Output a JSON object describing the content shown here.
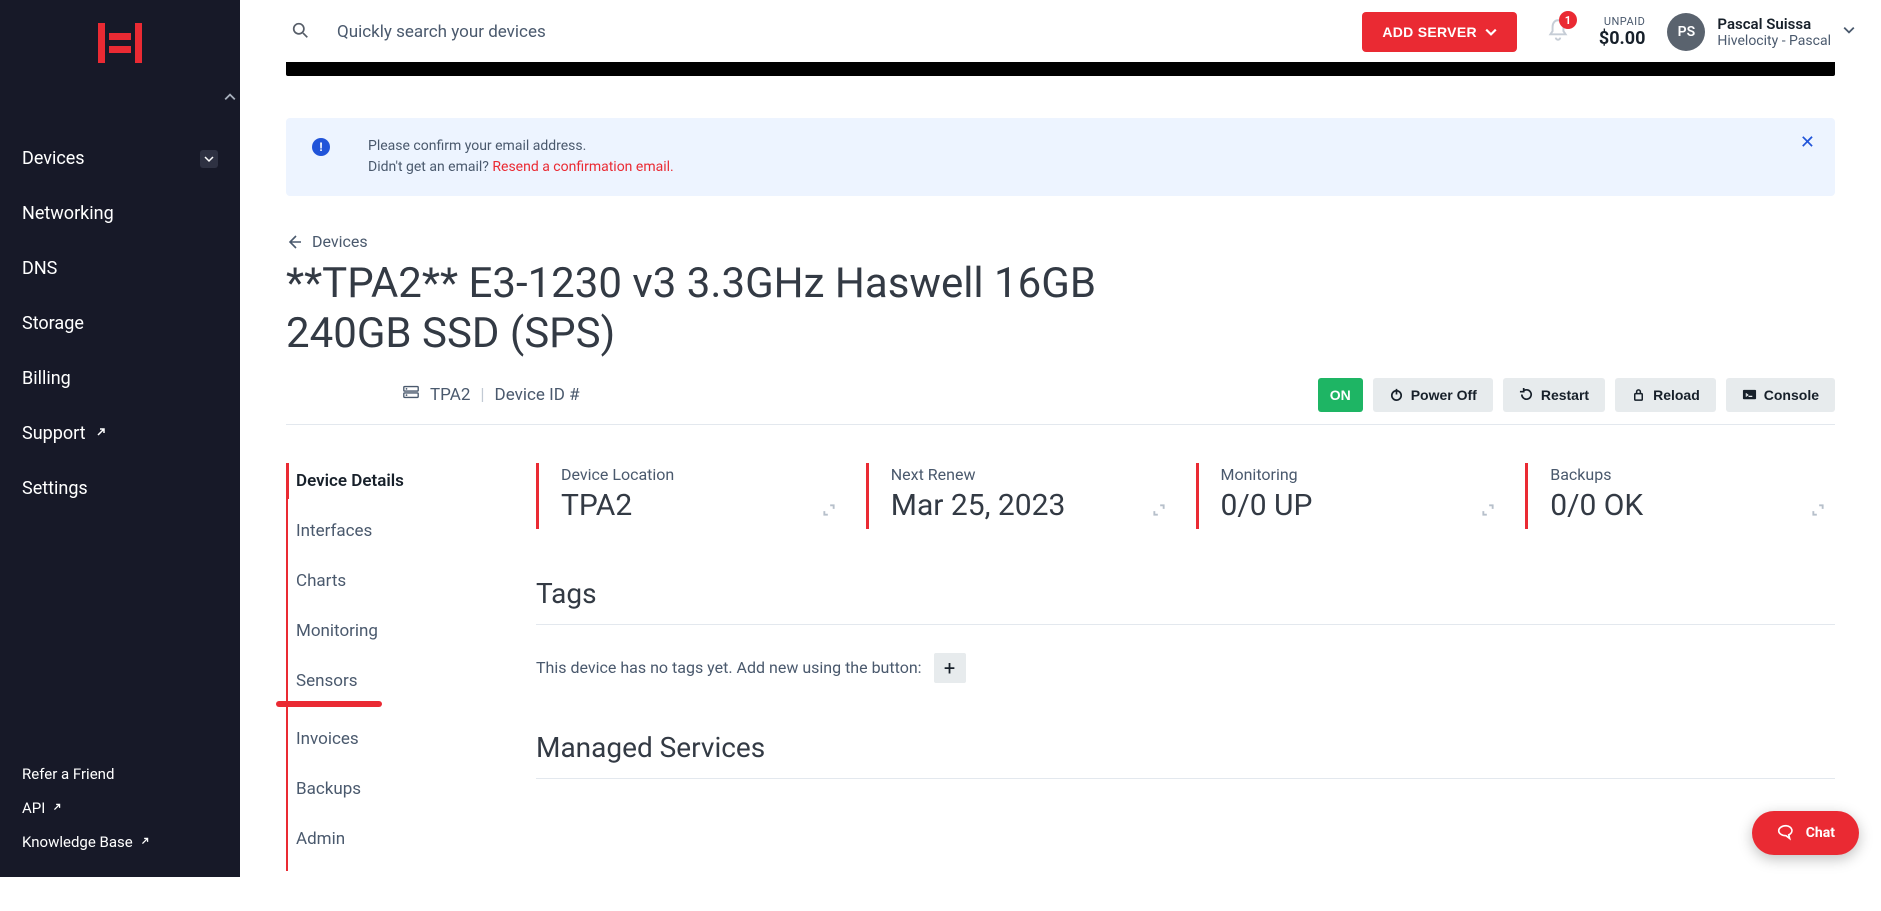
{
  "search": {
    "placeholder": "Quickly search your devices"
  },
  "header": {
    "add_server": "ADD SERVER",
    "notifications_count": "1",
    "unpaid_label": "UNPAID",
    "unpaid_amount": "$0.00",
    "user_initials": "PS",
    "user_name": "Pascal Suissa",
    "user_org": "Hivelocity - Pascal"
  },
  "sidebar": {
    "items": [
      {
        "label": "Devices",
        "expandable": true
      },
      {
        "label": "Networking"
      },
      {
        "label": "DNS"
      },
      {
        "label": "Storage"
      },
      {
        "label": "Billing"
      },
      {
        "label": "Support",
        "external": true
      },
      {
        "label": "Settings"
      }
    ],
    "bottom": [
      {
        "label": "Refer a Friend"
      },
      {
        "label": "API",
        "external": true
      },
      {
        "label": "Knowledge Base",
        "external": true
      }
    ]
  },
  "banner": {
    "line1": "Please confirm your email address.",
    "line2_pre": "Didn't get an email? ",
    "line2_link": "Resend a confirmation email."
  },
  "breadcrumb": {
    "label": "Devices"
  },
  "page": {
    "title": "**TPA2** E3-1230 v3 3.3GHz Haswell 16GB 240GB SSD (SPS)",
    "location_code": "TPA2",
    "device_id_label": "Device ID #"
  },
  "actions": {
    "on": "ON",
    "power_off": "Power Off",
    "restart": "Restart",
    "reload": "Reload",
    "console": "Console"
  },
  "tabs": [
    "Device Details",
    "Interfaces",
    "Charts",
    "Monitoring",
    "Sensors",
    "Invoices",
    "Backups",
    "Admin"
  ],
  "stats": [
    {
      "label": "Device Location",
      "value": "TPA2"
    },
    {
      "label": "Next Renew",
      "value": "Mar 25, 2023"
    },
    {
      "label": "Monitoring",
      "value": "0/0 UP"
    },
    {
      "label": "Backups",
      "value": "0/0 OK"
    }
  ],
  "sections": {
    "tags_heading": "Tags",
    "tags_empty": "This device has no tags yet. Add new using the button:",
    "managed_heading": "Managed Services"
  },
  "chat": {
    "label": "Chat"
  }
}
